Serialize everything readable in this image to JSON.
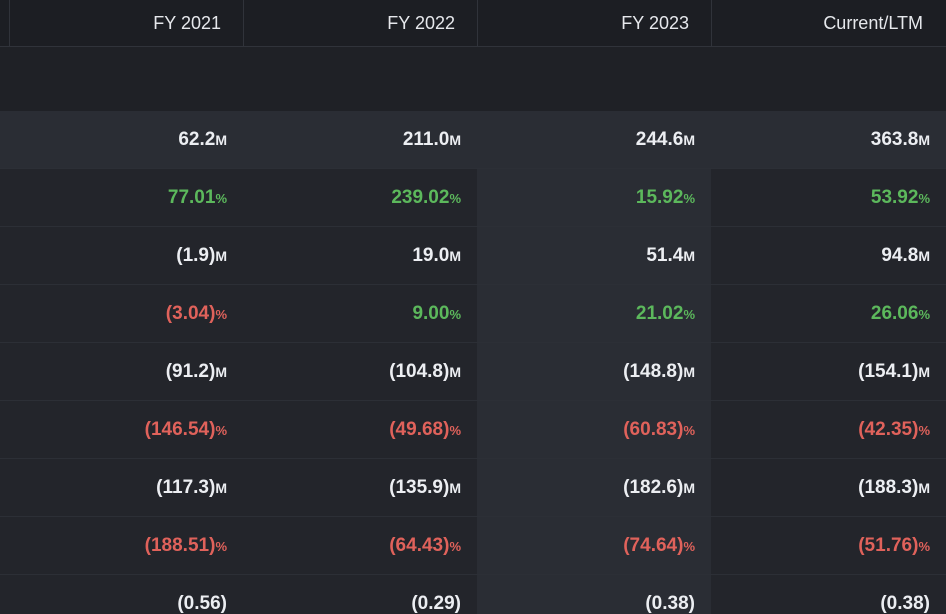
{
  "header": {
    "columns": [
      "FY 2021",
      "FY 2022",
      "FY 2023",
      "Current/LTM"
    ]
  },
  "rows": [
    {
      "kind": "value",
      "cells": [
        {
          "num": "62.2",
          "unit": "M",
          "tone": "neutral"
        },
        {
          "num": "211.0",
          "unit": "M",
          "tone": "neutral"
        },
        {
          "num": "244.6",
          "unit": "M",
          "tone": "neutral"
        },
        {
          "num": "363.8",
          "unit": "M",
          "tone": "neutral"
        }
      ]
    },
    {
      "kind": "pct",
      "cells": [
        {
          "num": "77.01",
          "unit": "%",
          "tone": "pos"
        },
        {
          "num": "239.02",
          "unit": "%",
          "tone": "pos"
        },
        {
          "num": "15.92",
          "unit": "%",
          "tone": "pos"
        },
        {
          "num": "53.92",
          "unit": "%",
          "tone": "pos"
        }
      ]
    },
    {
      "kind": "value",
      "cells": [
        {
          "num": "(1.9)",
          "unit": "M",
          "tone": "neutral"
        },
        {
          "num": "19.0",
          "unit": "M",
          "tone": "neutral"
        },
        {
          "num": "51.4",
          "unit": "M",
          "tone": "neutral"
        },
        {
          "num": "94.8",
          "unit": "M",
          "tone": "neutral"
        }
      ]
    },
    {
      "kind": "pct",
      "cells": [
        {
          "num": "(3.04)",
          "unit": "%",
          "tone": "neg"
        },
        {
          "num": "9.00",
          "unit": "%",
          "tone": "pos"
        },
        {
          "num": "21.02",
          "unit": "%",
          "tone": "pos"
        },
        {
          "num": "26.06",
          "unit": "%",
          "tone": "pos"
        }
      ]
    },
    {
      "kind": "value",
      "cells": [
        {
          "num": "(91.2)",
          "unit": "M",
          "tone": "neutral"
        },
        {
          "num": "(104.8)",
          "unit": "M",
          "tone": "neutral"
        },
        {
          "num": "(148.8)",
          "unit": "M",
          "tone": "neutral"
        },
        {
          "num": "(154.1)",
          "unit": "M",
          "tone": "neutral"
        }
      ]
    },
    {
      "kind": "pct",
      "cells": [
        {
          "num": "(146.54)",
          "unit": "%",
          "tone": "neg"
        },
        {
          "num": "(49.68)",
          "unit": "%",
          "tone": "neg"
        },
        {
          "num": "(60.83)",
          "unit": "%",
          "tone": "neg"
        },
        {
          "num": "(42.35)",
          "unit": "%",
          "tone": "neg"
        }
      ]
    },
    {
      "kind": "value",
      "cells": [
        {
          "num": "(117.3)",
          "unit": "M",
          "tone": "neutral"
        },
        {
          "num": "(135.9)",
          "unit": "M",
          "tone": "neutral"
        },
        {
          "num": "(182.6)",
          "unit": "M",
          "tone": "neutral"
        },
        {
          "num": "(188.3)",
          "unit": "M",
          "tone": "neutral"
        }
      ]
    },
    {
      "kind": "pct",
      "cells": [
        {
          "num": "(188.51)",
          "unit": "%",
          "tone": "neg"
        },
        {
          "num": "(64.43)",
          "unit": "%",
          "tone": "neg"
        },
        {
          "num": "(74.64)",
          "unit": "%",
          "tone": "neg"
        },
        {
          "num": "(51.76)",
          "unit": "%",
          "tone": "neg"
        }
      ]
    },
    {
      "kind": "eps",
      "cells": [
        {
          "num": "(0.56)",
          "unit": "",
          "tone": "neutral"
        },
        {
          "num": "(0.29)",
          "unit": "",
          "tone": "neutral"
        },
        {
          "num": "(0.38)",
          "unit": "",
          "tone": "neutral"
        },
        {
          "num": "(0.38)",
          "unit": "",
          "tone": "neutral"
        }
      ]
    }
  ],
  "colors": {
    "positive": "#5cb85c",
    "negative": "#e0625b",
    "text": "#eceef2",
    "background": "#23252b",
    "header_background": "#1c1e23"
  }
}
